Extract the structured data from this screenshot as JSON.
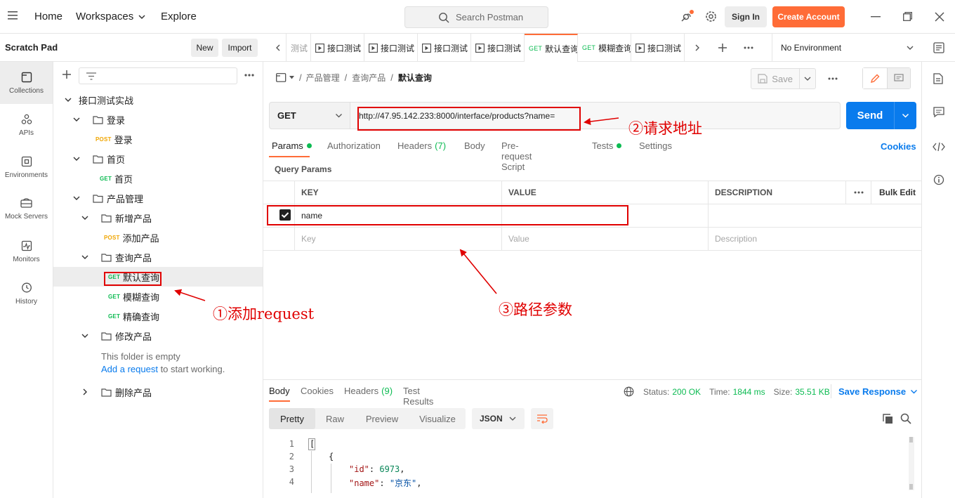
{
  "topbar": {
    "home": "Home",
    "workspaces": "Workspaces",
    "explore": "Explore",
    "search_placeholder": "Search Postman",
    "signin": "Sign In",
    "create_account": "Create Account"
  },
  "workspace": {
    "name": "Scratch Pad",
    "new": "New",
    "import": "Import"
  },
  "rail": [
    {
      "label": "Collections"
    },
    {
      "label": "APIs"
    },
    {
      "label": "Environments"
    },
    {
      "label": "Mock Servers"
    },
    {
      "label": "Monitors"
    },
    {
      "label": "History"
    }
  ],
  "tree": {
    "collection": "接口测试实战",
    "login_folder": "登录",
    "login_req": {
      "method": "POST",
      "name": "登录"
    },
    "home_folder": "首页",
    "home_req": {
      "method": "GET",
      "name": "首页"
    },
    "product_folder": "产品管理",
    "add_folder": "新增产品",
    "add_req": {
      "method": "POST",
      "name": "添加产品"
    },
    "query_folder": "查询产品",
    "query_reqs": [
      {
        "method": "GET",
        "name": "默认查询"
      },
      {
        "method": "GET",
        "name": "模糊查询"
      },
      {
        "method": "GET",
        "name": "精确查询"
      }
    ],
    "edit_folder": "修改产品",
    "empty_text": "This folder is empty",
    "add_request_link": "Add a request",
    "start_working": " to start working.",
    "delete_folder": "删除产品"
  },
  "tabs": {
    "items": [
      {
        "method": "",
        "name": "测试"
      },
      {
        "method": "",
        "name": "接口测试"
      },
      {
        "method": "",
        "name": "接口测试"
      },
      {
        "method": "",
        "name": "接口测试"
      },
      {
        "method": "",
        "name": "接口测试"
      },
      {
        "method": "GET",
        "name": "默认查询"
      },
      {
        "method": "GET",
        "name": "模糊查询"
      },
      {
        "method": "",
        "name": "接口测试"
      }
    ],
    "environment": "No Environment"
  },
  "breadcrumb": {
    "sep": "/",
    "p1": "产品管理",
    "p2": "查询产品",
    "current": "默认查询"
  },
  "request": {
    "save": "Save",
    "method": "GET",
    "url": "http://47.95.142.233:8000/interface/products?name=",
    "send": "Send"
  },
  "req_tabs": {
    "params": "Params",
    "authorization": "Authorization",
    "headers": "Headers",
    "headers_count": "(7)",
    "body": "Body",
    "prerequest": "Pre-request Script",
    "tests": "Tests",
    "settings": "Settings",
    "cookies": "Cookies"
  },
  "params": {
    "title": "Query Params",
    "col_key": "KEY",
    "col_value": "VALUE",
    "col_desc": "DESCRIPTION",
    "bulk_edit": "Bulk Edit",
    "row_key": "name",
    "ph_key": "Key",
    "ph_value": "Value",
    "ph_desc": "Description"
  },
  "annotations": {
    "a1": "①添加request",
    "a2": "②请求地址",
    "a3": "③路径参数"
  },
  "response": {
    "tabs": {
      "body": "Body",
      "cookies": "Cookies",
      "headers": "Headers",
      "headers_count": "(9)",
      "tests": "Test Results"
    },
    "status_label": "Status:",
    "status": "200 OK",
    "time_label": "Time:",
    "time": "1844 ms",
    "size_label": "Size:",
    "size": "35.51 KB",
    "save_response": "Save Response",
    "views": {
      "pretty": "Pretty",
      "raw": "Raw",
      "preview": "Preview",
      "visualize": "Visualize"
    },
    "format": "JSON",
    "lines": [
      {
        "n": "1",
        "text": "["
      },
      {
        "n": "2",
        "text": "{"
      },
      {
        "n": "3",
        "key": "\"id\"",
        "colon": ": ",
        "val": "6973",
        "comma": ","
      },
      {
        "n": "4",
        "key": "\"name\"",
        "colon": ": ",
        "val": "\"京东\"",
        "comma": ","
      }
    ]
  },
  "colors": {
    "accent": "#ff6c37",
    "send": "#097bed",
    "get": "#0cbb52",
    "post": "#f0a500",
    "annotation": "#e00000"
  }
}
